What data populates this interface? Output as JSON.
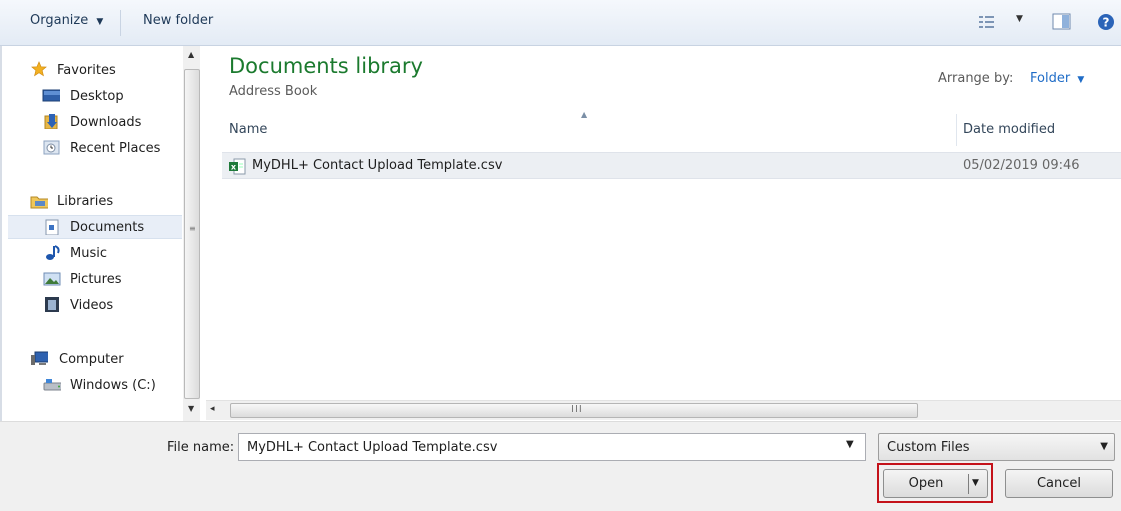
{
  "toolbar": {
    "organize_label": "Organize",
    "new_folder_label": "New folder"
  },
  "nav": {
    "favorites": {
      "label": "Favorites"
    },
    "desktop": {
      "label": "Desktop"
    },
    "downloads": {
      "label": "Downloads"
    },
    "recent_places": {
      "label": "Recent Places"
    },
    "libraries": {
      "label": "Libraries"
    },
    "documents": {
      "label": "Documents"
    },
    "music": {
      "label": "Music"
    },
    "pictures": {
      "label": "Pictures"
    },
    "videos": {
      "label": "Videos"
    },
    "computer": {
      "label": "Computer"
    },
    "windows_c": {
      "label": "Windows (C:)"
    }
  },
  "content": {
    "library_title": "Documents library",
    "library_subtitle": "Address Book",
    "arrange_by_label": "Arrange by:",
    "arrange_by_value": "Folder",
    "columns": {
      "name": "Name",
      "date_modified": "Date modified"
    },
    "files": [
      {
        "name": "MyDHL+ Contact Upload Template.csv",
        "date_modified": "05/02/2019 09:46",
        "icon": "excel-csv-icon"
      }
    ]
  },
  "scrollbar_grip": "III",
  "footer": {
    "file_name_label": "File name:",
    "file_name_value": "MyDHL+ Contact Upload Template.csv",
    "file_type_value": "Custom Files",
    "open_label": "Open",
    "cancel_label": "Cancel"
  },
  "colors": {
    "title_green": "#1b7a2e",
    "link_blue": "#1f6cc7",
    "highlight_red": "#c4121a"
  }
}
